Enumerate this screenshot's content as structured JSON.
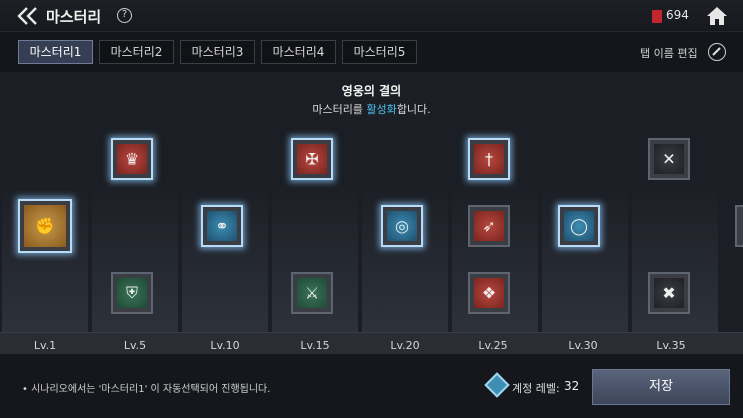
{
  "header": {
    "title": "마스터리",
    "help": "?",
    "currency": "694"
  },
  "tabs": [
    {
      "label": "마스터리1",
      "active": true
    },
    {
      "label": "마스터리2"
    },
    {
      "label": "마스터리3"
    },
    {
      "label": "마스터리4"
    },
    {
      "label": "마스터리5"
    }
  ],
  "tab_edit_label": "탭 이름 편집",
  "panel": {
    "heading": "영웅의 결의",
    "subtext_prefix": "마스터리를 ",
    "subtext_highlight": "활성화",
    "subtext_suffix": "합니다."
  },
  "levels": [
    "Lv.1",
    "Lv.5",
    "Lv.10",
    "Lv.15",
    "Lv.20",
    "Lv.25",
    "Lv.30",
    "Lv.35"
  ],
  "skills": [
    {
      "icon": "gauntlet-icon",
      "color": "gold",
      "active": true
    },
    {
      "icon": "crown-helm-icon",
      "color": "red",
      "active": true
    },
    {
      "icon": "shield-helm-icon",
      "color": "green",
      "active": false
    },
    {
      "icon": "chain-orb-icon",
      "color": "blue",
      "active": true
    },
    {
      "icon": "cross-shield-icon",
      "color": "red",
      "active": true
    },
    {
      "icon": "sword-strike-icon",
      "color": "green",
      "active": false
    },
    {
      "icon": "necklace-icon",
      "color": "blue",
      "active": true
    },
    {
      "icon": "sword-up-icon",
      "color": "red",
      "active": true
    },
    {
      "icon": "crossbow-icon",
      "color": "red",
      "active": false
    },
    {
      "icon": "winged-emblem-icon",
      "color": "red",
      "active": false
    },
    {
      "icon": "ring-icon",
      "color": "blue",
      "active": true
    },
    {
      "icon": "crossed-axes-icon",
      "color": "dark",
      "active": false
    },
    {
      "icon": "crossed-blades-icon",
      "color": "dark",
      "active": false
    }
  ],
  "footer": {
    "note": "• 시나리오에서는 '마스터리1' 이 자동선택되어 진행됩니다.",
    "account_level_label": "계정 레벨:",
    "account_level_value": "32",
    "save_label": "저장"
  }
}
